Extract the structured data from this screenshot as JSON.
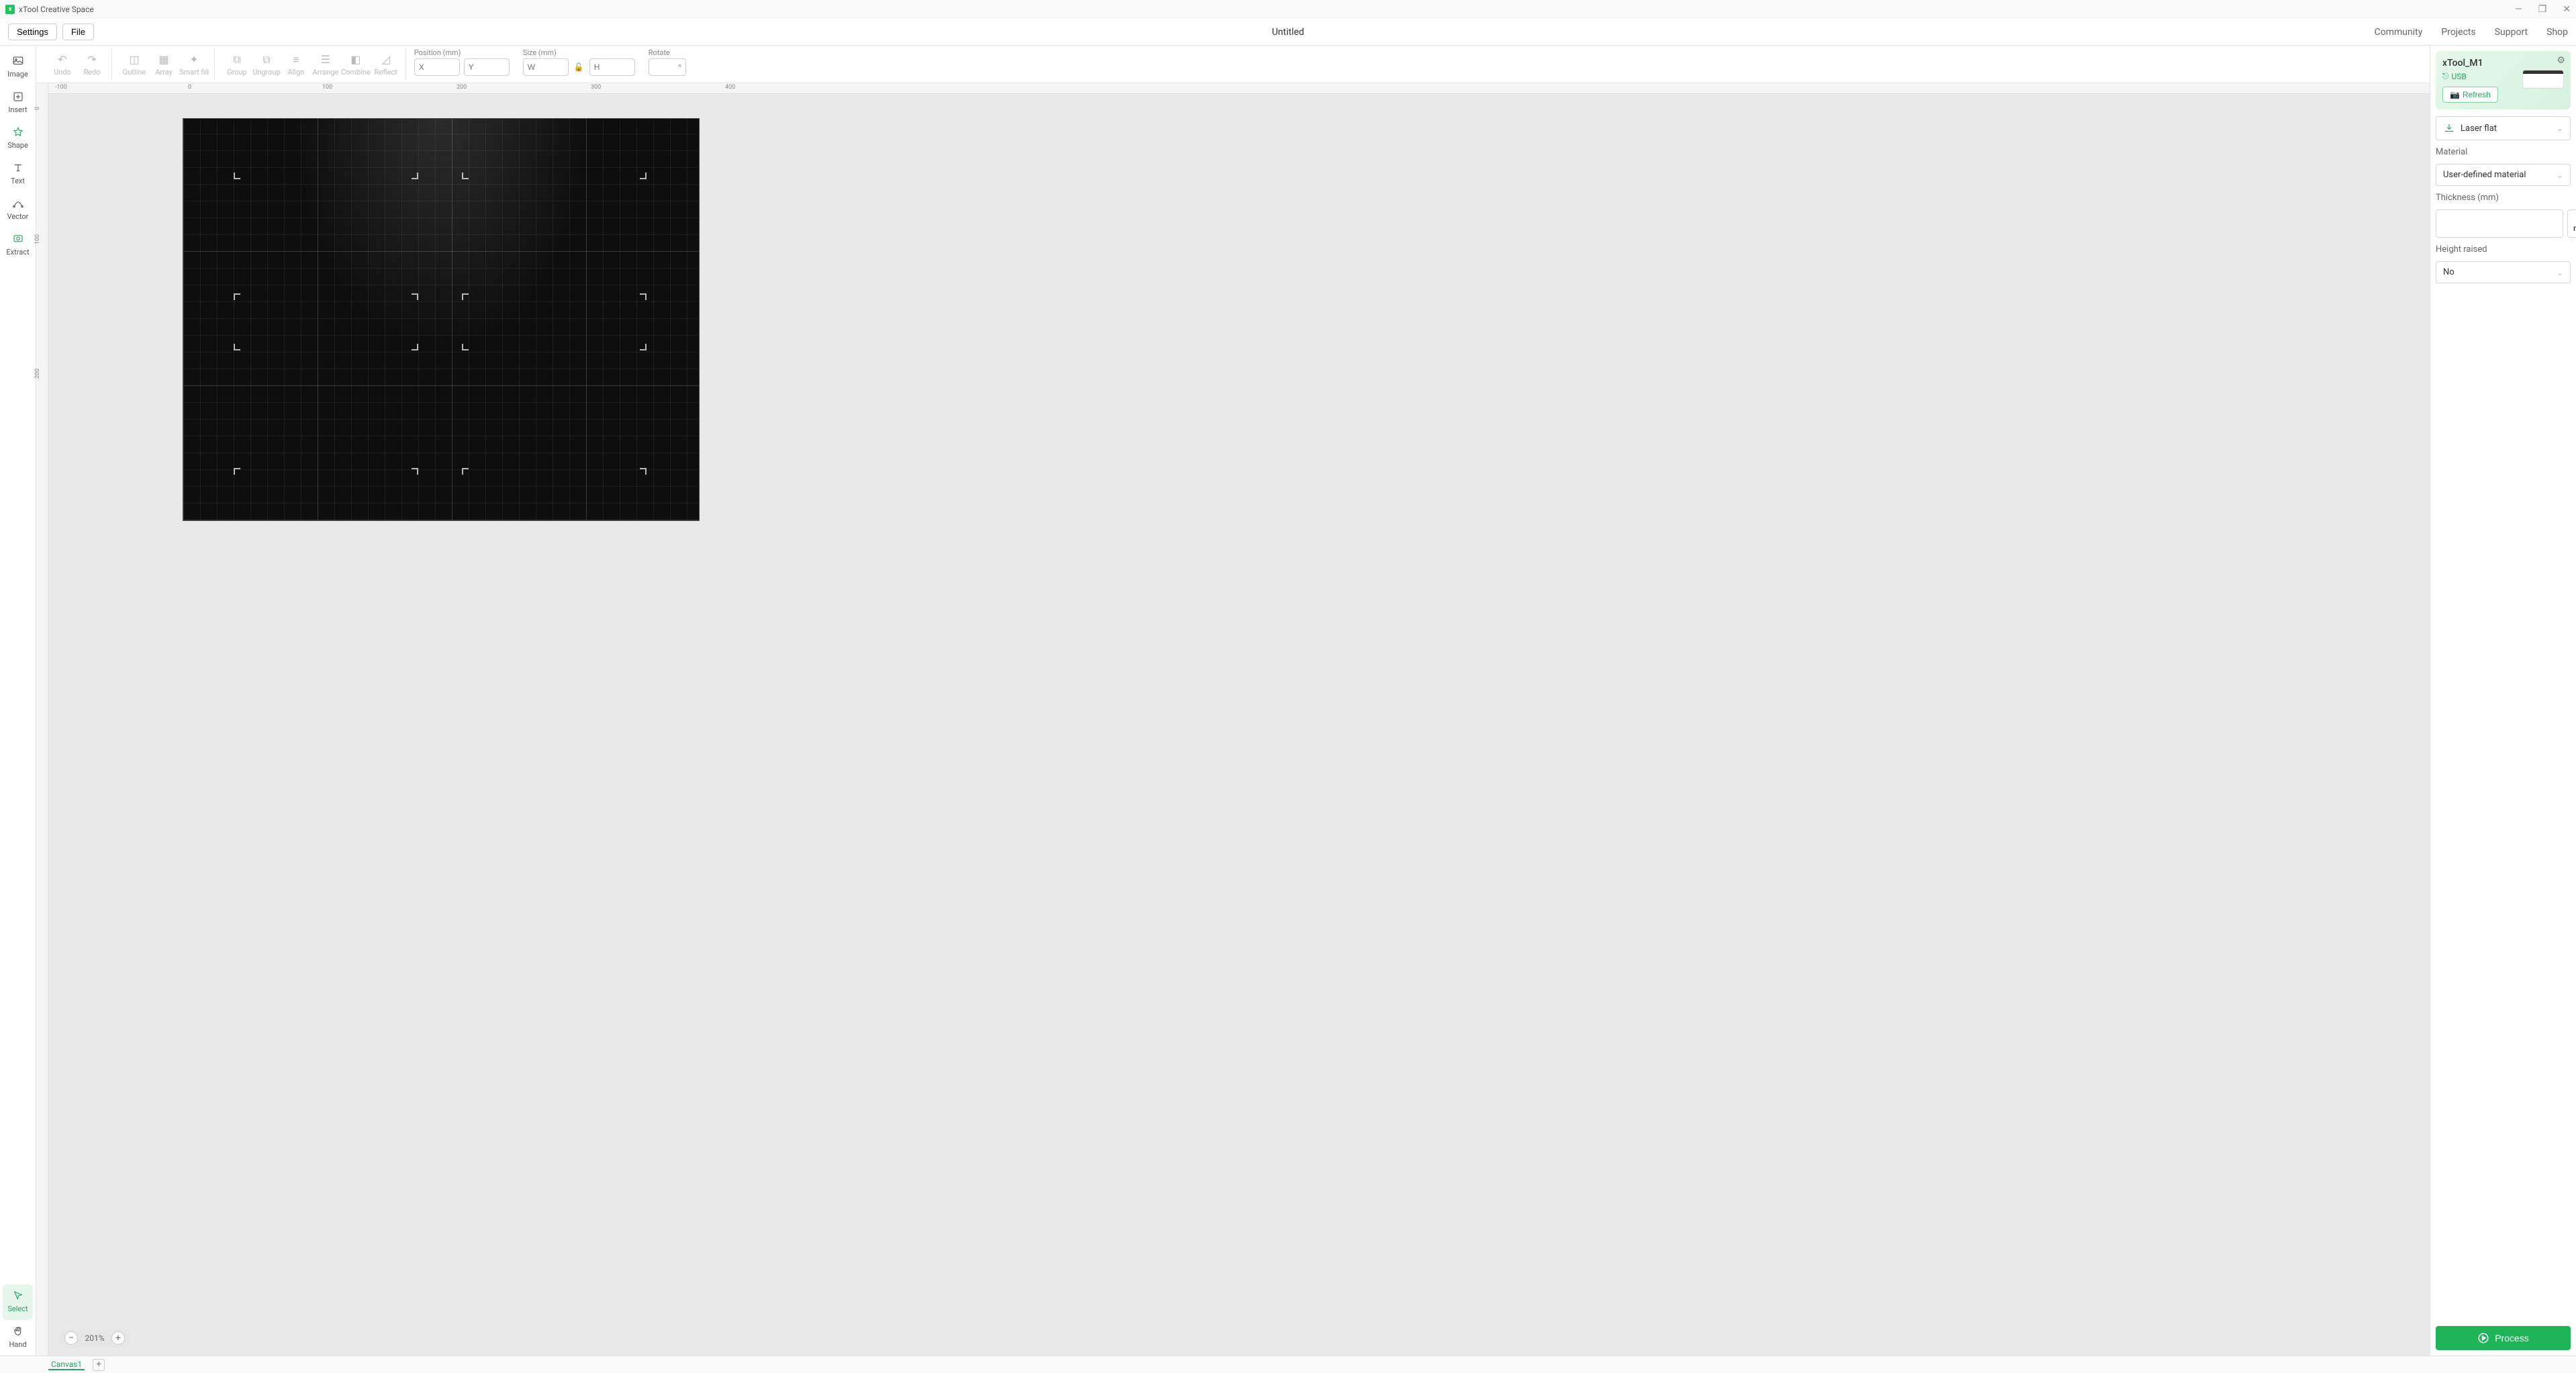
{
  "app": {
    "title": "xTool Creative Space"
  },
  "window": {
    "min": "—",
    "max": "❐",
    "close": "✕"
  },
  "menu": {
    "settings": "Settings",
    "file": "File",
    "doc_title": "Untitled",
    "right": {
      "community": "Community",
      "projects": "Projects",
      "support": "Support",
      "shop": "Shop"
    }
  },
  "left_tools": {
    "image": "Image",
    "insert": "Insert",
    "shape": "Shape",
    "text": "Text",
    "vector": "Vector",
    "extract": "Extract",
    "select": "Select",
    "hand": "Hand"
  },
  "toolbar": {
    "undo": "Undo",
    "redo": "Redo",
    "outline": "Outline",
    "array": "Array",
    "smartfill": "Smart fill",
    "group": "Group",
    "ungroup": "Ungroup",
    "align": "Align",
    "arrange": "Arrange",
    "combine": "Combine",
    "reflect": "Reflect"
  },
  "props": {
    "position_label": "Position (mm)",
    "x_ph": "X",
    "y_ph": "Y",
    "size_label": "Size (mm)",
    "w_ph": "W",
    "h_ph": "H",
    "rotate_label": "Rotate",
    "rotate_ph": "°"
  },
  "ruler": {
    "h": [
      "-100",
      "0",
      "100",
      "200",
      "300",
      "400"
    ],
    "v": [
      "0",
      "100",
      "200"
    ]
  },
  "zoom": {
    "value": "201%"
  },
  "device": {
    "name": "xTool_M1",
    "conn": "USB",
    "refresh": "Refresh"
  },
  "panel": {
    "mode": "Laser flat",
    "material_label": "Material",
    "material": "User-defined material",
    "thickness_label": "Thickness (mm)",
    "auto_measure": "Auto-measure",
    "height_label": "Height raised",
    "height": "No",
    "process": "Process"
  },
  "tabs": {
    "canvas1": "Canvas1"
  }
}
